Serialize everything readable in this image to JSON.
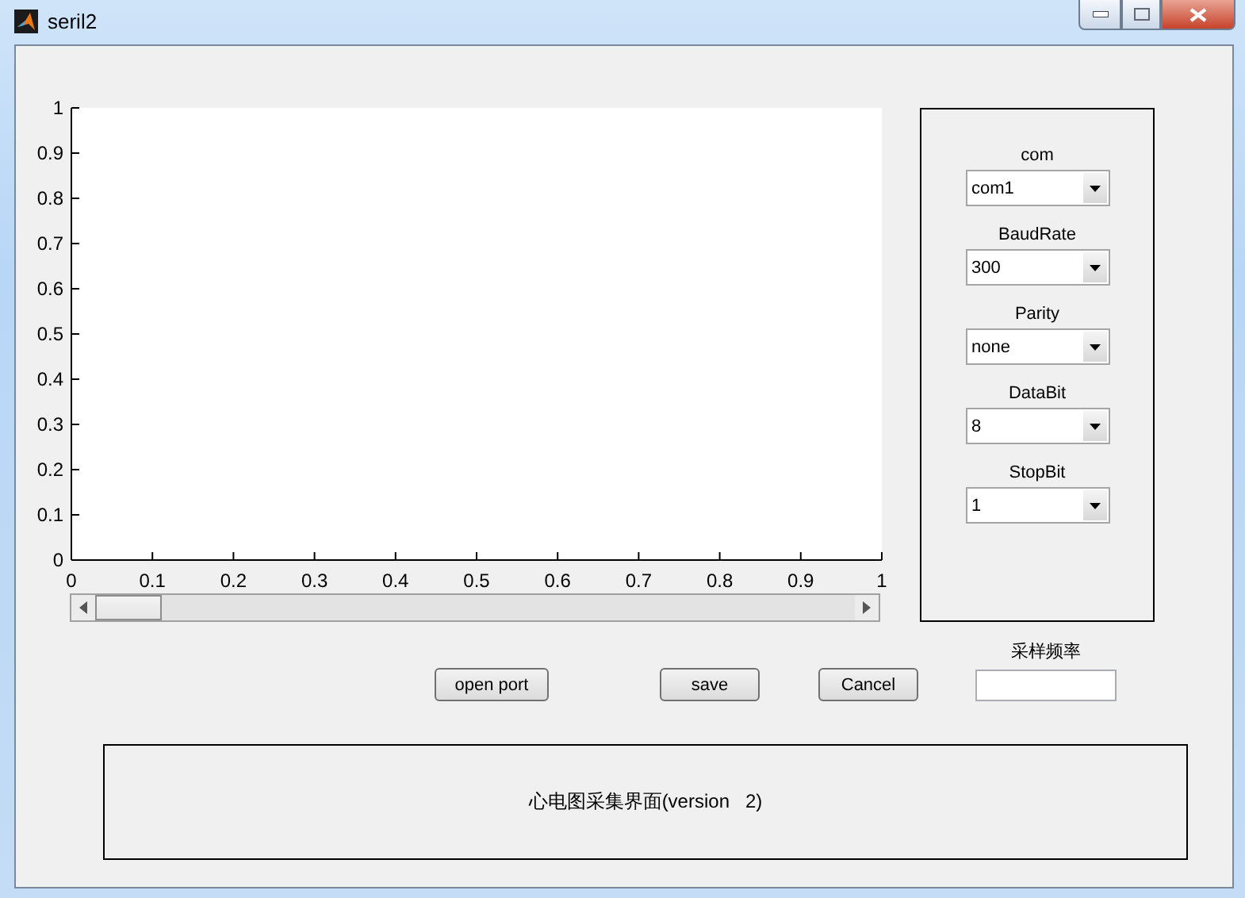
{
  "window": {
    "title": "seril2"
  },
  "axes": {
    "chart_data": {
      "type": "line",
      "xlim": [
        0,
        1
      ],
      "ylim": [
        0,
        1
      ],
      "xticks": [
        0,
        0.1,
        0.2,
        0.3,
        0.4,
        0.5,
        0.6,
        0.7,
        0.8,
        0.9,
        1
      ],
      "yticks": [
        0,
        0.1,
        0.2,
        0.3,
        0.4,
        0.5,
        0.6,
        0.7,
        0.8,
        0.9,
        1
      ]
    }
  },
  "slider": {
    "level": 0
  },
  "settings": [
    {
      "label": "com",
      "value": "com1"
    },
    {
      "label": "BaudRate",
      "value": "300"
    },
    {
      "label": "Parity",
      "value": "none"
    },
    {
      "label": "DataBit",
      "value": "8"
    },
    {
      "label": "StopBit",
      "value": "1"
    }
  ],
  "buttons": [
    "open port",
    "save",
    "Cancel"
  ],
  "sample_rate": {
    "label": "采样频率"
  },
  "caption": "心电图采集界面(version   2)"
}
